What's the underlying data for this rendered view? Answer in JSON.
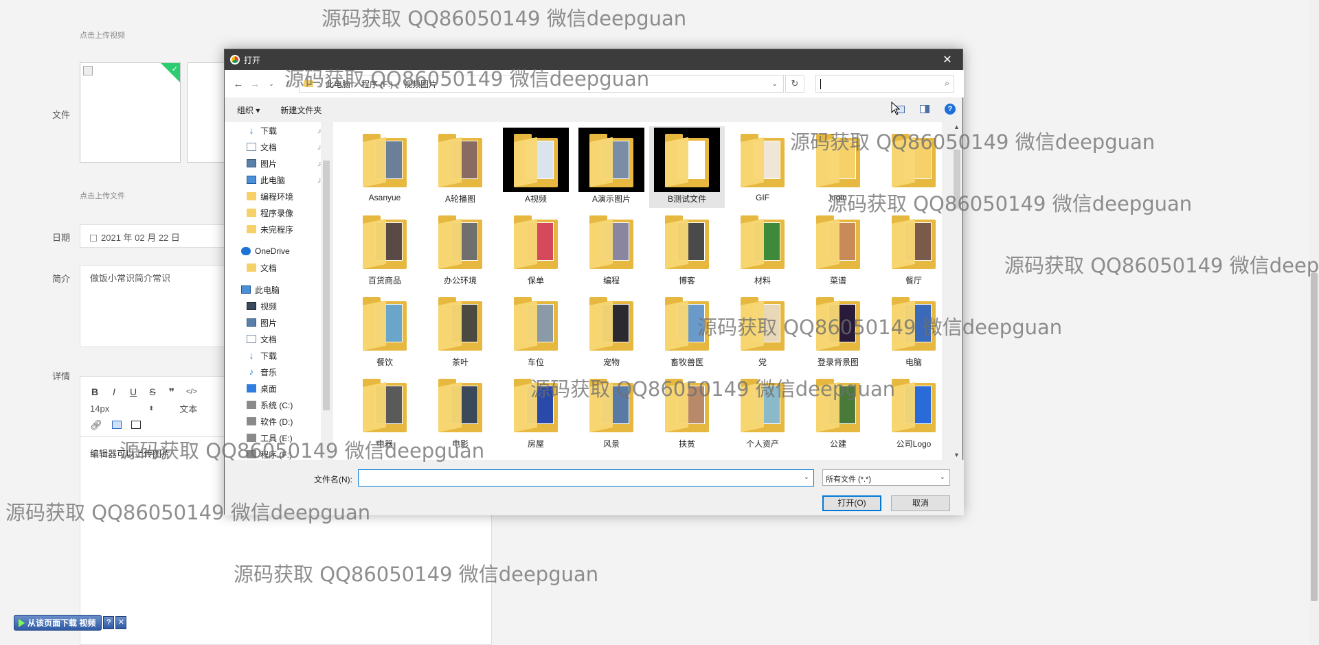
{
  "form": {
    "upload_video_hint": "点击上传视频",
    "file_label": "文件",
    "upload_file_hint": "点击上传文件",
    "date_label": "日期",
    "date_value": "2021 年 02 月 22 日",
    "intro_label": "简介",
    "intro_value": "做饭小常识简介常识",
    "detail_label": "详情",
    "editor_font_size": "14px",
    "editor_block_type": "文本",
    "editor_content": "编辑器可以上传图片",
    "download_bar_label": "从该页面下载 视频",
    "download_help": "?",
    "download_close": "✕"
  },
  "dialog": {
    "title": "打开",
    "address": [
      "此电脑",
      "程序 (F:)",
      "视频图片"
    ],
    "search_placeholder": "",
    "toolbar": {
      "organize": "组织 ▾",
      "new_folder": "新建文件夹"
    },
    "nav_items": [
      {
        "label": "下载",
        "icon": "download-icon",
        "pinned": true
      },
      {
        "label": "文档",
        "icon": "document-icon",
        "pinned": true
      },
      {
        "label": "图片",
        "icon": "picture-icon",
        "pinned": true
      },
      {
        "label": "此电脑",
        "icon": "computer-icon",
        "pinned": true
      },
      {
        "label": "编程环境",
        "icon": "folder-icon",
        "pinned": false
      },
      {
        "label": "程序录像",
        "icon": "folder-icon",
        "pinned": false
      },
      {
        "label": "未完程序",
        "icon": "folder-icon",
        "pinned": false
      },
      {
        "label": "OneDrive",
        "icon": "cloud-icon",
        "pinned": false,
        "gap": true
      },
      {
        "label": "文档",
        "icon": "folder-icon",
        "pinned": false
      },
      {
        "label": "此电脑",
        "icon": "computer-icon",
        "pinned": false,
        "gap": true
      },
      {
        "label": "视频",
        "icon": "video-icon",
        "pinned": false
      },
      {
        "label": "图片",
        "icon": "picture-icon",
        "pinned": false
      },
      {
        "label": "文档",
        "icon": "document-icon",
        "pinned": false
      },
      {
        "label": "下载",
        "icon": "download-icon",
        "pinned": false
      },
      {
        "label": "音乐",
        "icon": "music-icon",
        "pinned": false
      },
      {
        "label": "桌面",
        "icon": "desktop-icon",
        "pinned": false
      },
      {
        "label": "系统 (C:)",
        "icon": "drive-icon",
        "pinned": false
      },
      {
        "label": "软件 (D:)",
        "icon": "drive-icon",
        "pinned": false
      },
      {
        "label": "工具 (E:)",
        "icon": "drive-icon",
        "pinned": false
      },
      {
        "label": "程序 (F:)",
        "icon": "drive-icon",
        "pinned": false
      }
    ],
    "folders": [
      {
        "label": "Asanyue",
        "color": "#6b7f99"
      },
      {
        "label": "A轮播图",
        "color": "#8a6b62"
      },
      {
        "label": "A视频",
        "color": "#d9e4ec",
        "dark": true
      },
      {
        "label": "A演示图片",
        "color": "#7b8ca6",
        "dark": true
      },
      {
        "label": "B测试文件",
        "color": "#ffffff",
        "dark": true,
        "selected": true
      },
      {
        "label": "GIF",
        "color": "#f0e6d8"
      },
      {
        "label": "login",
        "color": "#f6d068"
      },
      {
        "label": "",
        "color": "#f6d068"
      },
      {
        "label": "百货商品",
        "color": "#5a4a45"
      },
      {
        "label": "办公环境",
        "color": "#6f6f6f"
      },
      {
        "label": "保单",
        "color": "#d44a5a"
      },
      {
        "label": "编程",
        "color": "#8a86a0"
      },
      {
        "label": "博客",
        "color": "#4a4a4a"
      },
      {
        "label": "材料",
        "color": "#3f8a3a"
      },
      {
        "label": "菜谱",
        "color": "#c98a5a"
      },
      {
        "label": "餐厅",
        "color": "#7a5a4a"
      },
      {
        "label": "餐饮",
        "color": "#6aa6c9"
      },
      {
        "label": "茶叶",
        "color": "#4a4a40"
      },
      {
        "label": "车位",
        "color": "#8a9aa6"
      },
      {
        "label": "宠物",
        "color": "#2a2a30"
      },
      {
        "label": "畜牧兽医",
        "color": "#6a9ac9"
      },
      {
        "label": "党",
        "color": "#e8d8b8"
      },
      {
        "label": "登录背景图",
        "color": "#2a1a3a"
      },
      {
        "label": "电脑",
        "color": "#3a6ab9"
      },
      {
        "label": "电器",
        "color": "#5a5a5a"
      },
      {
        "label": "电影",
        "color": "#3a4a5a"
      },
      {
        "label": "房屋",
        "color": "#2a4aa9"
      },
      {
        "label": "风景",
        "color": "#5a7aa6"
      },
      {
        "label": "扶贫",
        "color": "#b98a6a"
      },
      {
        "label": "个人资产",
        "color": "#8ab9c9"
      },
      {
        "label": "公建",
        "color": "#4a7a3a"
      },
      {
        "label": "公司Logo",
        "color": "#2a6ad9"
      }
    ],
    "filename_label": "文件名(N):",
    "filename_value": "",
    "filetype": "所有文件 (*.*)",
    "open_button": "打开(O)",
    "cancel_button": "取消"
  },
  "watermark": "源码获取 QQ86050149 微信deepguan",
  "colors": {
    "titlebar": "#3c3c3c",
    "accent": "#0078d7",
    "folder": "#f8d775"
  }
}
